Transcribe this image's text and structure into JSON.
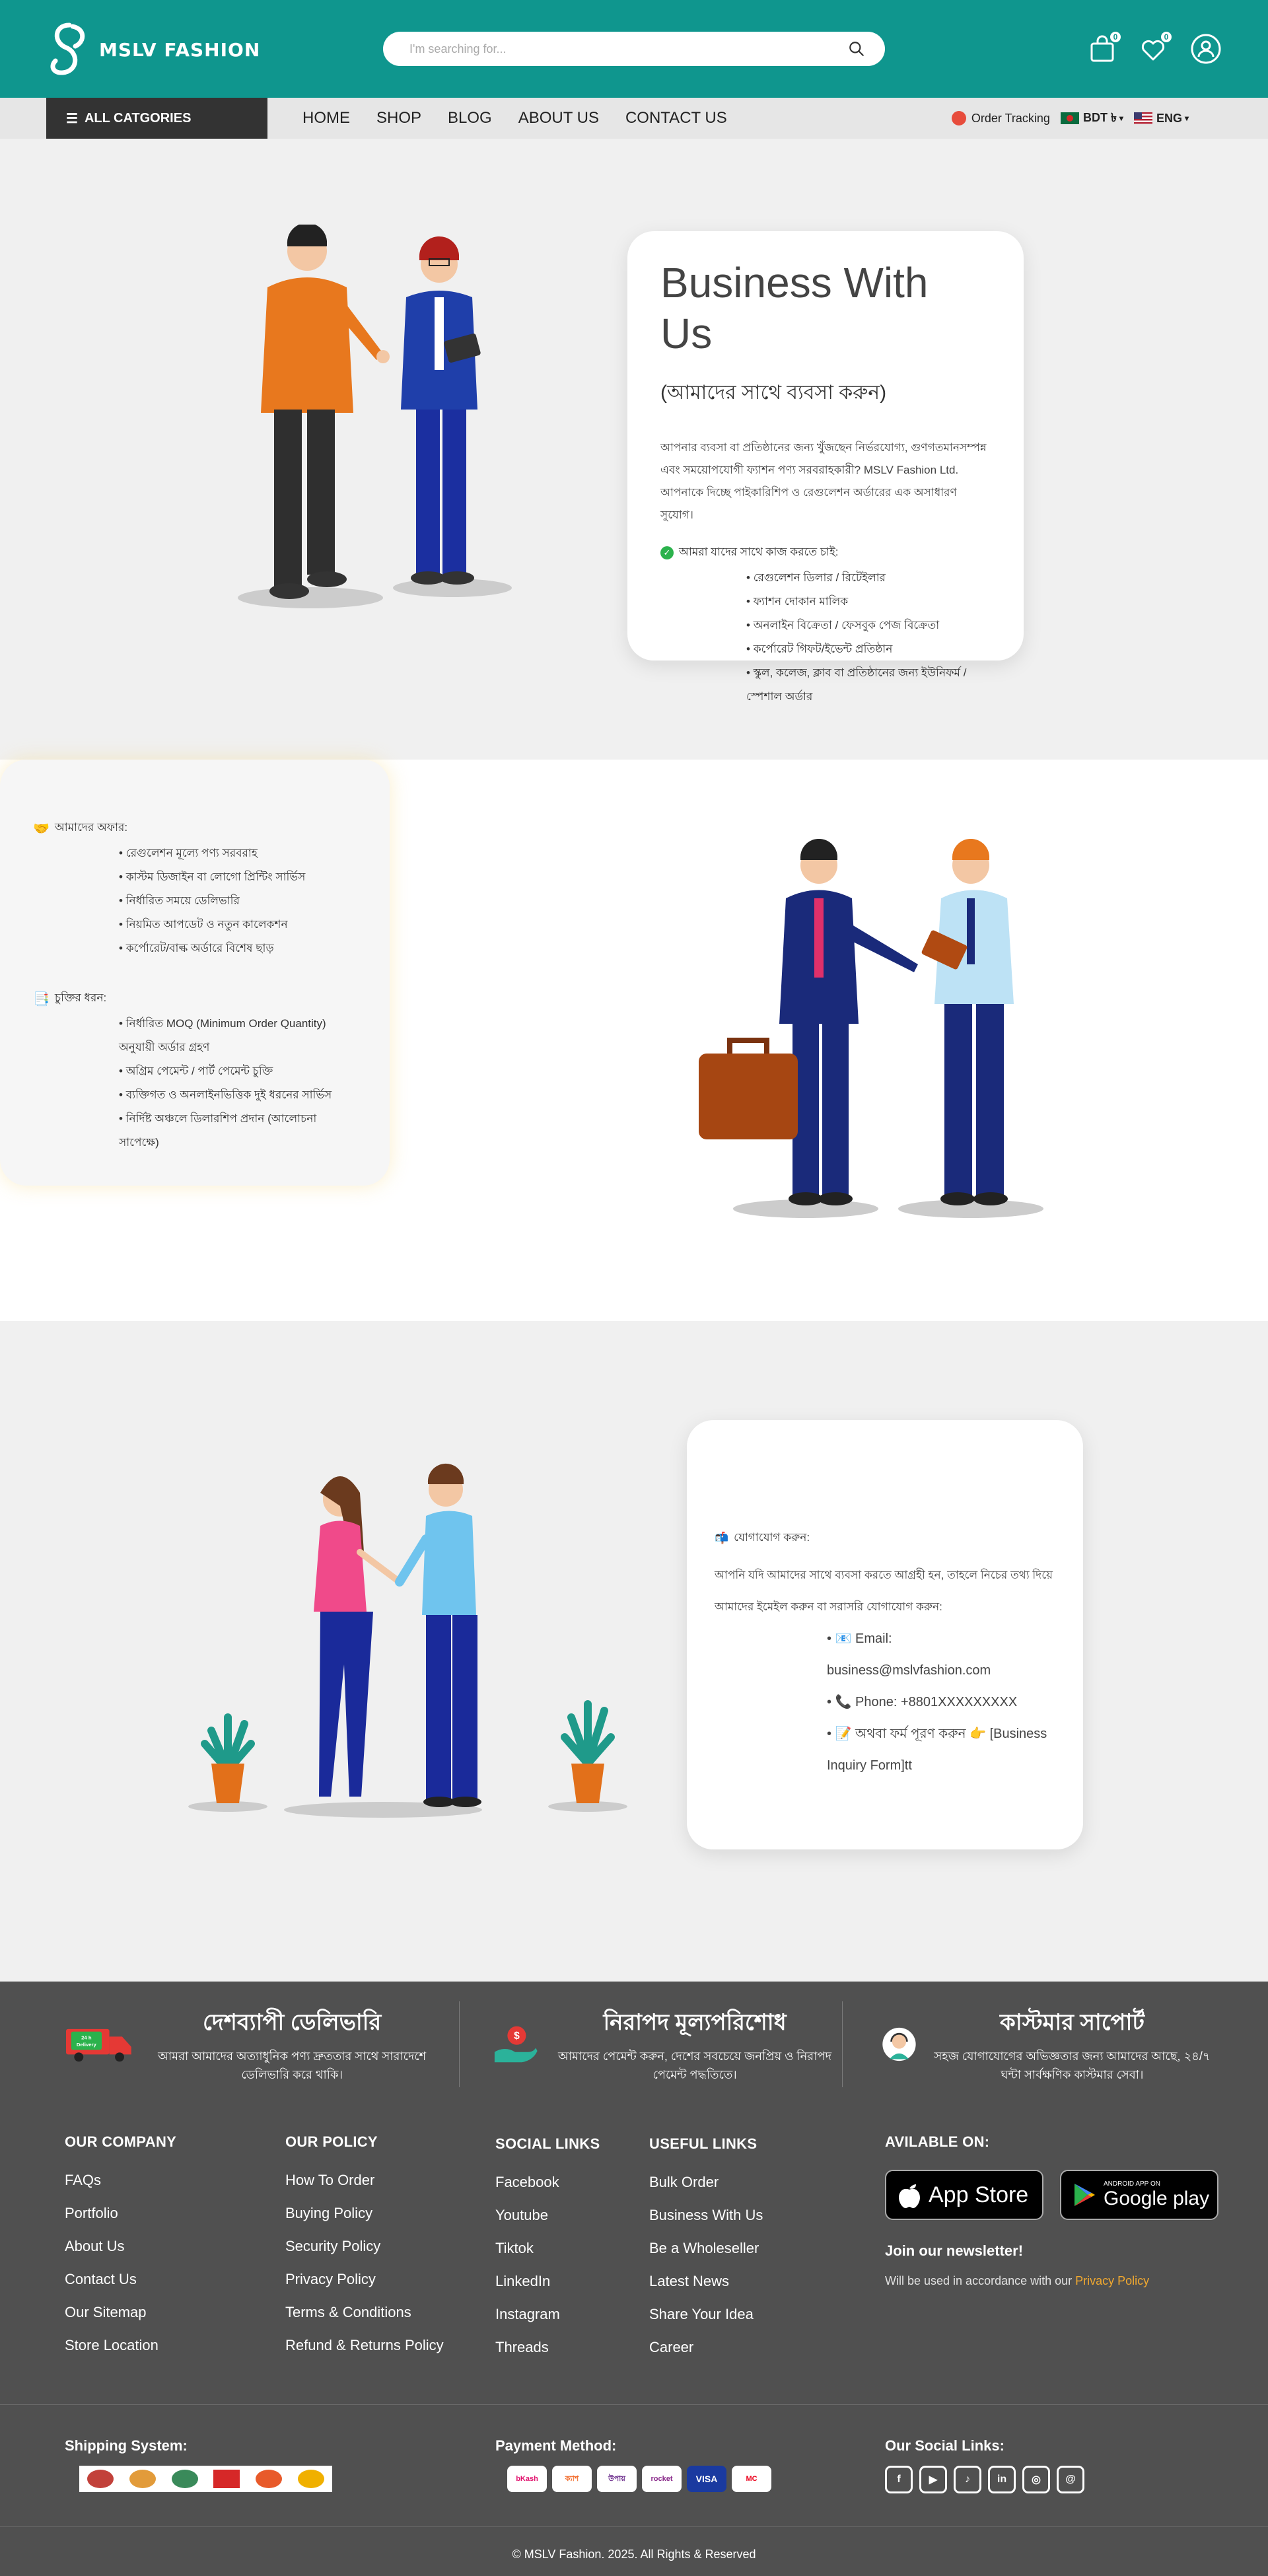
{
  "header": {
    "brand": "MSLV FASHION",
    "search_placeholder": "I'm searching for...",
    "cart_count": "0",
    "wishlist_count": "0"
  },
  "nav": {
    "categories_label": "ALL CATGORIES",
    "menu": [
      "HOME",
      "SHOP",
      "BLOG",
      "ABOUT US",
      "CONTACT US"
    ],
    "order_tracking": "Order Tracking",
    "currency": "BDT ৳",
    "language": "ENG"
  },
  "section1": {
    "title": "Business With Us",
    "subtitle": "(আমাদের সাথে ব্যবসা করুন)",
    "intro": "আপনার ব্যবসা বা প্রতিষ্ঠানের জন্য খুঁজছেন নির্ভরযোগ্য, গুণগতমানসম্পন্ন এবং সময়োপযোগী ফ্যাশন পণ্য সরবরাহকারী? MSLV Fashion Ltd. আপনাকে দিচ্ছে পাইকারিশিপ ও রেগুলেশন অর্ডারের এক অসাধারণ সুযোগ।",
    "who_heading": "আমরা যাদের সাথে কাজ করতে চাই:",
    "who_list": [
      "রেগুলেশন ডিলার / রিটেইলার",
      "ফ্যাশন দোকান মালিক",
      "অনলাইন বিক্রেতা / ফেসবুক পেজ বিক্রেতা",
      "কর্পোরেট গিফট/ইভেন্ট প্রতিষ্ঠান",
      "স্কুল, কলেজ, ক্লাব বা প্রতিষ্ঠানের জন্য ইউনিফর্ম / স্পেশাল অর্ডার"
    ]
  },
  "section2": {
    "offer_emoji": "🤝",
    "offer_heading": "আমাদের অফার:",
    "offer_list": [
      "রেগুলেশন মূল্যে পণ্য সরবরাহ",
      "কাস্টম ডিজাইন বা লোগো প্রিন্টিং সার্ভিস",
      "নির্ধারিত সময়ে ডেলিভারি",
      "নিয়মিত আপডেট ও নতুন কালেকশন",
      "কর্পোরেট/বাল্ক অর্ডারে বিশেষ ছাড়"
    ],
    "terms_emoji": "📑",
    "terms_heading": "চুক্তির ধরন:",
    "terms_list": [
      "নির্ধারিত MOQ (Minimum Order Quantity) অনুযায়ী অর্ডার গ্রহণ",
      "অগ্রিম পেমেন্ট / পার্ট পেমেন্ট চুক্তি",
      "ব্যক্তিগত ও অনলাইনভিত্তিক দুই ধরনের সার্ভিস",
      "নির্দিষ্ট অঞ্চলে ডিলারশিপ প্রদান (আলোচনা সাপেক্ষে)"
    ]
  },
  "section3": {
    "contact_emoji": "📬",
    "contact_heading": "যোগাযোগ করুন:",
    "contact_intro": "আপনি যদি আমাদের সাথে ব্যবসা করতে আগ্রহী হন, তাহলে নিচের তথ্য দিয়ে আমাদের ইমেইল করুন বা সরাসরি যোগাযোগ করুন:",
    "contact_list": [
      "📧 Email: business@mslvfashion.com",
      "📞 Phone: +8801XXXXXXXXX",
      "📝 অথবা ফর্ম পূরণ করুন 👉 [Business Inquiry Form]tt"
    ]
  },
  "features": [
    {
      "badge": "24 h Delivery",
      "title": "দেশব্যাপী ডেলিভারি",
      "desc": "আমরা আমাদের অত্যাধুনিক পণ্য দ্রুততার সাথে সারাদেশে ডেলিভারি করে থাকি।"
    },
    {
      "title": "নিরাপদ মূল্যপরিশোধ",
      "desc": "আমাদের পেমেন্ট করুন, দেশের সবচেয়ে জনপ্রিয় ও নিরাপদ পেমেন্ট পদ্ধতিতে।"
    },
    {
      "title": "কাস্টমার সাপোর্ট",
      "desc": "সহজ যোগাযোগের অভিজ্ঞতার জন্য আমাদের আছে, ২৪/৭ ঘন্টা সার্বক্ষণিক কাস্টমার সেবা।"
    }
  ],
  "footer": {
    "company": {
      "title": "OUR COMPANY",
      "links": [
        "FAQs",
        "Portfolio",
        "About Us",
        "Contact Us",
        "Our Sitemap",
        "Store Location"
      ]
    },
    "policy": {
      "title": "OUR POLICY",
      "links": [
        "How To Order",
        "Buying Policy",
        "Security Policy",
        "Privacy Policy",
        "Terms & Conditions",
        "Refund & Returns Policy"
      ]
    },
    "social": {
      "title": "SOCIAL LINKS",
      "links": [
        "Facebook",
        "Youtube",
        "Tiktok",
        "LinkedIn",
        "Instagram",
        "Threads"
      ]
    },
    "useful": {
      "title": "USEFUL LINKS",
      "links": [
        "Bulk Order",
        "Business With Us",
        "Be a Wholeseller",
        "Latest News",
        "Share Your Idea",
        "Career"
      ]
    },
    "available_on": "AVILABLE ON:",
    "appstore": {
      "small": "",
      "big": "App Store"
    },
    "googleplay": {
      "small": "ANDROID APP ON",
      "big": "Google play"
    },
    "newsletter_title": "Join our newsletter!",
    "newsletter_note": "Will be used in accordance with our ",
    "newsletter_link": "Privacy Policy",
    "shipping_title": "Shipping System:",
    "payment_title": "Payment Method:",
    "payments": [
      "bKash",
      "ক্যাশ",
      "উপায়",
      "rocket",
      "VISA",
      "MC"
    ],
    "social_title": "Our Social Links:",
    "copyright": "© MSLV Fashion. 2025. All Rights & Reserved"
  }
}
